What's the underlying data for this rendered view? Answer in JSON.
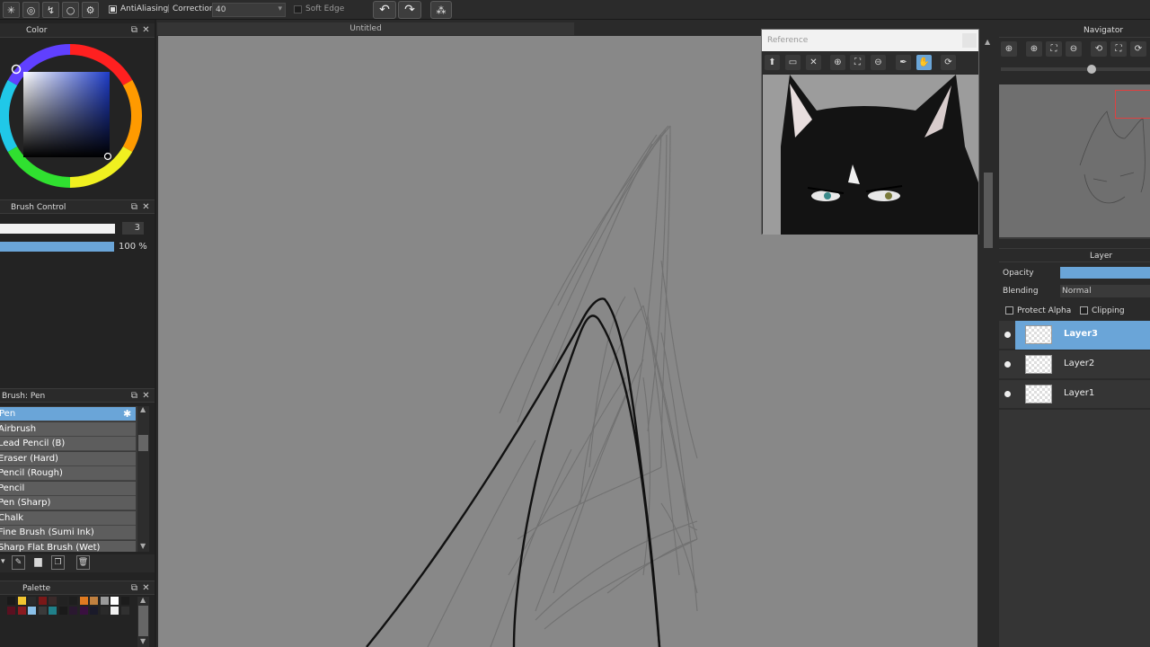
{
  "toolbar": {
    "antialiasing_label": "AntiAliasing",
    "correction_label": "Correction",
    "correction_value": "40",
    "soft_edge_label": "Soft Edge"
  },
  "canvas": {
    "tab_title": "Untitled"
  },
  "color_panel": {
    "title": "Color"
  },
  "brush_control": {
    "title": "Brush Control",
    "size_value": "3",
    "opacity_value": "100 %",
    "opacity_fraction": 1.0
  },
  "brush_panel": {
    "title": "Brush: Pen",
    "items": [
      {
        "label": "Pen",
        "selected": true
      },
      {
        "label": "Airbrush"
      },
      {
        "label": "Lead Pencil (B)"
      },
      {
        "label": "Eraser (Hard)"
      },
      {
        "label": "Pencil (Rough)"
      },
      {
        "label": "Pencil"
      },
      {
        "label": "Pen (Sharp)"
      },
      {
        "label": "Chalk"
      },
      {
        "label": "Fine Brush (Sumi Ink)"
      },
      {
        "label": "Sharp Flat Brush (Wet)"
      }
    ]
  },
  "palette": {
    "title": "Palette",
    "colors_row1": [
      "#1a1a1a",
      "#f2c530",
      "#2a2a2a",
      "#7a1818",
      "#3a2a2a",
      "#222222",
      "#1e1e1e",
      "#e07a20",
      "#c08040",
      "#9a9a9a",
      "#ffffff",
      "#1c1c1c"
    ],
    "colors_row2": [
      "#5a1020",
      "#8a1a20",
      "#8ac0e8",
      "#3a3a3a",
      "#20808a",
      "#1a1a1a",
      "#2a1830",
      "#3a1040",
      "#1a1a2a",
      "#2a2a2a",
      "#f0f0f0",
      "#303030"
    ]
  },
  "reference": {
    "title": "Reference"
  },
  "navigator": {
    "title": "Navigator"
  },
  "layer_panel": {
    "title": "Layer",
    "opacity_label": "Opacity",
    "blending_label": "Blending",
    "blending_value": "Normal",
    "protect_alpha_label": "Protect Alpha",
    "clipping_label": "Clipping",
    "layers": [
      {
        "name": "Layer3",
        "selected": true
      },
      {
        "name": "Layer2"
      },
      {
        "name": "Layer1"
      }
    ]
  }
}
